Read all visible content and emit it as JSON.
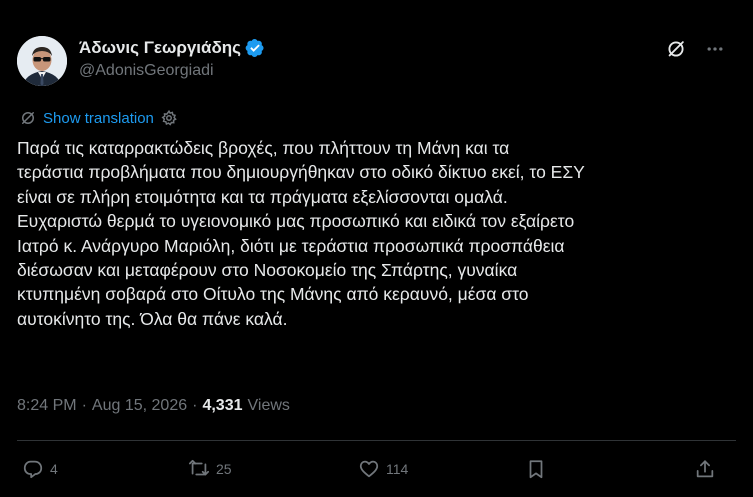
{
  "author": {
    "display_name": "Άδωνις Γεωργιάδης",
    "handle": "@AdonisGeorgiadi",
    "verified_color": "#1d9bf0"
  },
  "translate": {
    "label": "Show translation"
  },
  "tweet": {
    "text": "Παρά τις καταρρακτώδεις βροχές, που πλήττουν τη Μάνη και τα\nτεράστια προβλήματα που δημιουργήθηκαν στο οδικό δίκτυο εκεί, το ΕΣΥ\nείναι σε πλήρη ετοιμότητα και τα πράγματα εξελίσσονται ομαλά.\nΕυχαριστώ θερμά το υγειονομικό μας προσωπικό και ειδικά τον εξαίρετο\nΙατρό κ. Ανάργυρο Μαριόλη, διότι με τεράστια προσωπικά προσπάθεια\nδιέσωσαν και μεταφέρουν στο Νοσοκομείο της Σπάρτης, γυναίκα\nκτυπημένη σοβαρά στο Οίτυλο της Μάνης από κεραυνό, μέσα στο\nαυτοκίνητο της. Όλα θα πάνε καλά."
  },
  "meta": {
    "time": "8:24 PM",
    "separator": "·",
    "date": "Aug 15, 2026",
    "views_count": "4,331",
    "views_label": "Views"
  },
  "actions": {
    "replies": "4",
    "reposts": "25",
    "likes": "114"
  },
  "icons": {
    "grok": "grok-icon",
    "more": "more-icon",
    "translate": "translate-icon",
    "settings": "gear-icon",
    "reply": "reply-icon",
    "repost": "repost-icon",
    "like": "like-icon",
    "bookmark": "bookmark-icon",
    "share": "share-icon"
  }
}
